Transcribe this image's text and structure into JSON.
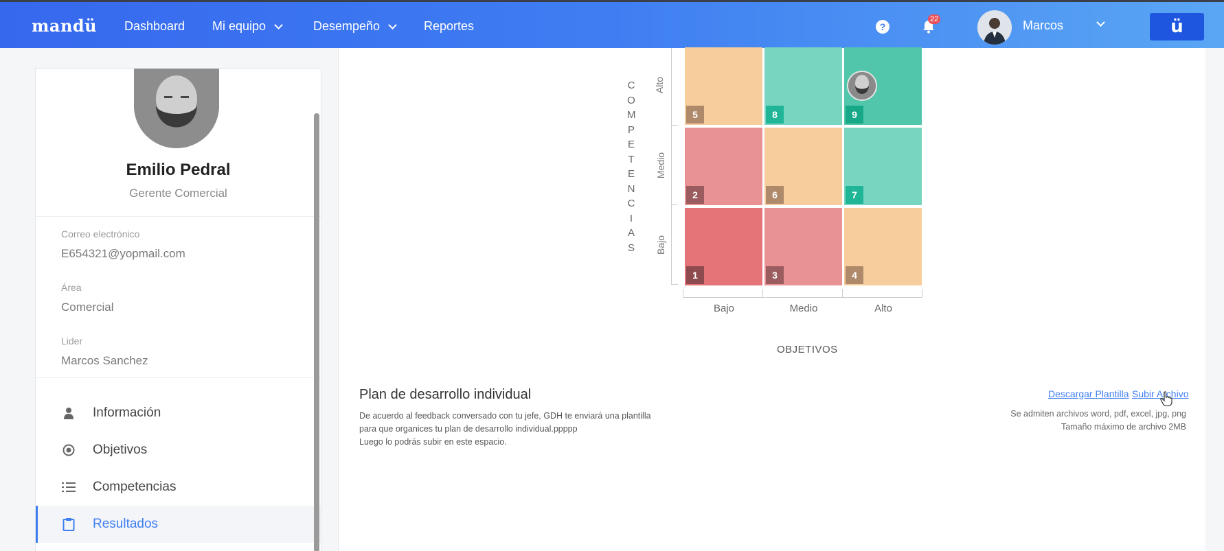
{
  "header": {
    "logo": "mandü",
    "nav": [
      {
        "label": "Dashboard"
      },
      {
        "label": "Mi equipo"
      },
      {
        "label": "Desempeño"
      },
      {
        "label": "Reportes"
      }
    ],
    "help_glyph": "?",
    "notifications_count": "22",
    "user_name": "Marcos",
    "brand_button": "ü"
  },
  "profile": {
    "name": "Emilio Pedral",
    "role": "Gerente Comercial",
    "fields": [
      {
        "label": "Correo electrónico",
        "value": "E654321@yopmail.com"
      },
      {
        "label": "Área",
        "value": "Comercial"
      },
      {
        "label": "Lider",
        "value": "Marcos Sanchez"
      }
    ]
  },
  "menu": [
    {
      "label": "Información",
      "icon": "person-icon"
    },
    {
      "label": "Objetivos",
      "icon": "target-icon"
    },
    {
      "label": "Competencias",
      "icon": "list-icon"
    },
    {
      "label": "Resultados",
      "icon": "clipboard-icon",
      "active": true
    }
  ],
  "ninebox": {
    "y_title": "COMPETENCIAS",
    "y_levels": [
      "Alto",
      "Medio",
      "Bajo"
    ],
    "x_levels": [
      "Bajo",
      "Medio",
      "Alto"
    ],
    "x_title": "OBJETIVOS",
    "rows": [
      [
        "5",
        "8",
        "9"
      ],
      [
        "2",
        "6",
        "7"
      ],
      [
        "1",
        "3",
        "4"
      ]
    ],
    "colors": {
      "orange": "#f8cd9d",
      "teal_light": "#77d5c0",
      "teal_dark": "#52c6ab",
      "pink": "#e89294",
      "red": "#e57478"
    }
  },
  "plan": {
    "title": "Plan de desarrollo individual",
    "desc_lines": [
      "De acuerdo al feedback conversado con tu jefe, GDH te enviará una plantilla",
      "para que organices tu plan de desarrollo individual.ppppp",
      "Luego lo podrás subir en este espacio."
    ],
    "download_link": "Descargar Plantilla",
    "upload_link": "Subir Archivo",
    "note_formats": "Se admiten archivos word, pdf, excel, jpg, png",
    "note_size": "Tamaño máximo de archivo 2MB"
  }
}
